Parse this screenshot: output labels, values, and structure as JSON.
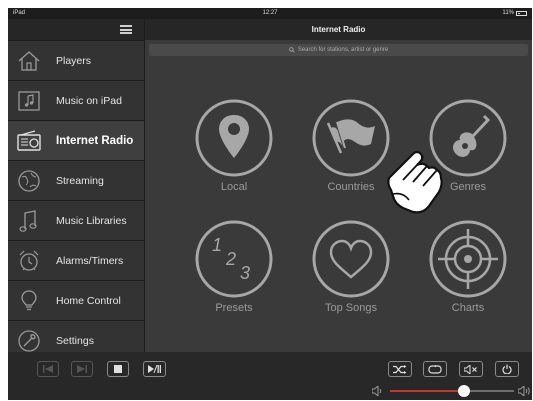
{
  "status_bar": {
    "device": "iPad",
    "time": "12:27",
    "battery": "11%"
  },
  "sidebar": {
    "items": [
      {
        "label": "Players",
        "icon": "house-icon"
      },
      {
        "label": "Music on iPad",
        "icon": "music-note-icon"
      },
      {
        "label": "Internet Radio",
        "icon": "radio-icon",
        "active": true
      },
      {
        "label": "Streaming",
        "icon": "globe-icon"
      },
      {
        "label": "Music Libraries",
        "icon": "music-notes-icon"
      },
      {
        "label": "Alarms/Timers",
        "icon": "alarm-clock-icon"
      },
      {
        "label": "Home Control",
        "icon": "lightbulb-icon"
      },
      {
        "label": "Settings",
        "icon": "wrench-icon"
      }
    ]
  },
  "main": {
    "title": "Internet Radio",
    "search_placeholder": "Search for stations, artist or genre",
    "tiles": [
      {
        "label": "Local",
        "icon": "location-pin-icon"
      },
      {
        "label": "Countries",
        "icon": "flag-icon"
      },
      {
        "label": "Genres",
        "icon": "guitar-icon"
      },
      {
        "label": "Presets",
        "icon": "numbers-icon"
      },
      {
        "label": "Top Songs",
        "icon": "heart-icon"
      },
      {
        "label": "Charts",
        "icon": "crosshair-icon"
      }
    ]
  },
  "playback": {
    "volume_level": 0.6,
    "colors": {
      "volume_fill": "#c0392b",
      "background": "#3a3a3a"
    }
  }
}
